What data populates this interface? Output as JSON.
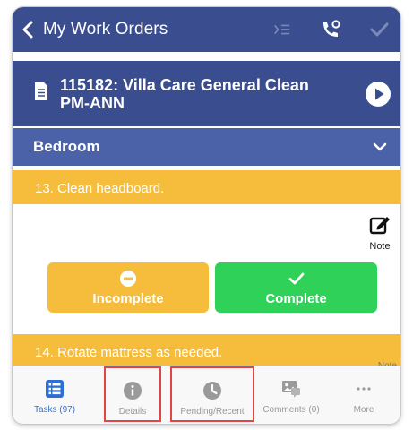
{
  "nav": {
    "back_label": "My Work Orders"
  },
  "work_order": {
    "title_line1": "115182: Villa Care General Clean",
    "title_line2": "PM-ANN"
  },
  "section": {
    "title": "Bedroom"
  },
  "tasks": [
    {
      "label": "13.  Clean headboard."
    },
    {
      "label": "14.  Rotate mattress as needed."
    }
  ],
  "task_actions": {
    "note_label": "Note",
    "incomplete_label": "Incomplete",
    "complete_label": "Complete",
    "note_peek": "Note"
  },
  "tabbar": {
    "tabs": [
      {
        "label": "Tasks (97)",
        "icon": "list-icon",
        "active": true
      },
      {
        "label": "Details",
        "icon": "info-icon"
      },
      {
        "label": "Pending/Recent",
        "icon": "clock-icon"
      },
      {
        "label": "Comments (0)",
        "icon": "photo-comment-icon"
      },
      {
        "label": "More",
        "icon": "more-icon"
      }
    ]
  },
  "colors": {
    "header": "#3a4d8f",
    "section": "#4b62a9",
    "task_bar": "#f5bd3b",
    "complete": "#30d158",
    "active_tab": "#2d6fd6",
    "highlight_box": "#e04646"
  }
}
